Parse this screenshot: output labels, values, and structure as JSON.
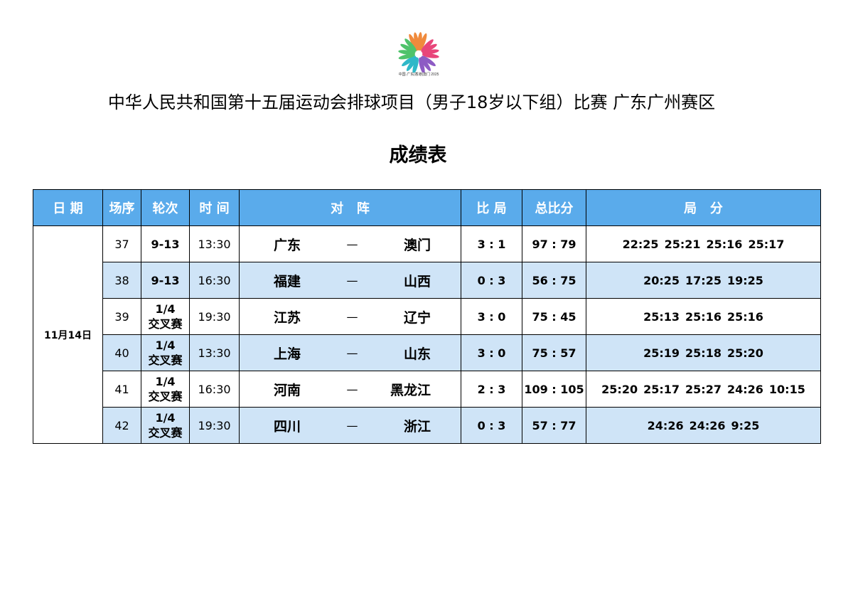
{
  "logo": {
    "caption": "中国·广东|香港|澳门 2025"
  },
  "header": {
    "title": "中华人民共和国第十五届运动会排球项目（男子18岁以下组）比赛 广东广州赛区",
    "subtitle": "成绩表"
  },
  "table": {
    "columns": [
      "日 期",
      "场序",
      "轮次",
      "时 间",
      "对   阵",
      "比 局",
      "总比分",
      "局   分"
    ],
    "date": "11月14日",
    "rows": [
      {
        "no": "37",
        "round": [
          "9-13"
        ],
        "time": "13:30",
        "home": "广东",
        "dash": "—",
        "away": "澳门",
        "sets_score": "3 : 1",
        "total": "97 : 79",
        "sets": [
          "22:25",
          "25:21",
          "25:16",
          "25:17"
        ]
      },
      {
        "no": "38",
        "round": [
          "9-13"
        ],
        "time": "16:30",
        "home": "福建",
        "dash": "—",
        "away": "山西",
        "sets_score": "0 : 3",
        "total": "56 : 75",
        "sets": [
          "20:25",
          "17:25",
          "19:25"
        ]
      },
      {
        "no": "39",
        "round": [
          "1/4",
          "交叉赛"
        ],
        "time": "19:30",
        "home": "江苏",
        "dash": "—",
        "away": "辽宁",
        "sets_score": "3 : 0",
        "total": "75 : 45",
        "sets": [
          "25:13",
          "25:16",
          "25:16"
        ]
      },
      {
        "no": "40",
        "round": [
          "1/4",
          "交叉赛"
        ],
        "time": "13:30",
        "home": "上海",
        "dash": "—",
        "away": "山东",
        "sets_score": "3 : 0",
        "total": "75 : 57",
        "sets": [
          "25:19",
          "25:18",
          "25:20"
        ]
      },
      {
        "no": "41",
        "round": [
          "1/4",
          "交叉赛"
        ],
        "time": "16:30",
        "home": "河南",
        "dash": "—",
        "away": "黑龙江",
        "sets_score": "2 : 3",
        "total": "109 : 105",
        "sets": [
          "25:20",
          "25:17",
          "25:27",
          "24:26",
          "10:15"
        ]
      },
      {
        "no": "42",
        "round": [
          "1/4",
          "交叉赛"
        ],
        "time": "19:30",
        "home": "四川",
        "dash": "—",
        "away": "浙江",
        "sets_score": "0 : 3",
        "total": "57 : 77",
        "sets": [
          "24:26",
          "24:26",
          "9:25"
        ]
      }
    ]
  },
  "colors": {
    "header_bg": "#5aabeb",
    "row_alt": "#cfe4f7",
    "header_text": "#ffffff"
  }
}
